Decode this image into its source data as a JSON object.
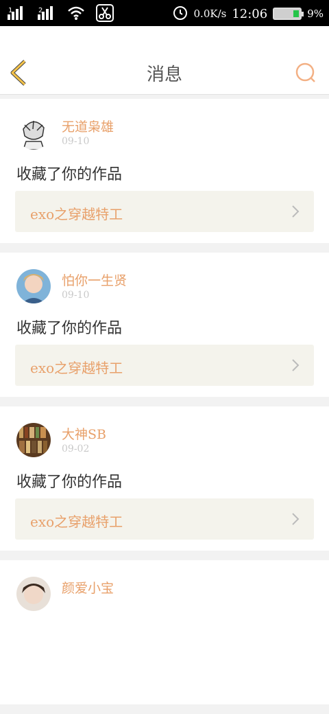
{
  "status_bar": {
    "sim1": "1",
    "sim2": "2",
    "speed": "0.0K/s",
    "time": "12:06",
    "battery": "9%"
  },
  "header": {
    "title": "消息"
  },
  "colors": {
    "accent": "#e8a06a",
    "back_icon": "#f3c24a",
    "search_icon": "#f3b084"
  },
  "messages": [
    {
      "username": "无道枭雄",
      "date": "09-10",
      "action": "收藏了你的作品",
      "work_title": "exo之穿越特工"
    },
    {
      "username": "怕你一生贤",
      "date": "09-10",
      "action": "收藏了你的作品",
      "work_title": "exo之穿越特工"
    },
    {
      "username": "大神SB",
      "date": "09-02",
      "action": "收藏了你的作品",
      "work_title": "exo之穿越特工"
    },
    {
      "username": "颜爱小宝",
      "date": "",
      "action": "",
      "work_title": ""
    }
  ]
}
